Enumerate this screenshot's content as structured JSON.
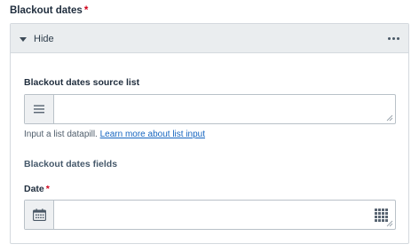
{
  "field": {
    "label": "Blackout dates",
    "required_mark": "*"
  },
  "panel": {
    "toggle_label": "Hide",
    "source_list": {
      "label": "Blackout dates source list",
      "value": "",
      "hint_text": "Input a list datapill.",
      "hint_link": "Learn more about list input"
    },
    "fields_heading": "Blackout dates fields",
    "date": {
      "label": "Date",
      "required_mark": "*",
      "value": ""
    }
  },
  "icons": {
    "toggle": "caret-down-icon",
    "more": "more-horizontal-icon",
    "list": "list-icon",
    "calendar": "calendar-icon",
    "keypad": "keypad-icon"
  }
}
